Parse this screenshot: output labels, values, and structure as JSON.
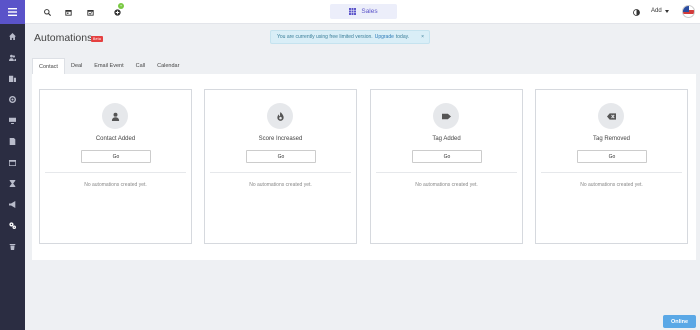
{
  "topbar": {
    "icons": [
      "search-icon",
      "calendar-icon",
      "calendar-check-icon",
      "add-circle-icon"
    ],
    "notification_count": "+",
    "workspace_label": "Sales",
    "add_label": "Add"
  },
  "sidebar": {
    "items": [
      "home-icon",
      "users-icon",
      "building-icon",
      "target-icon",
      "monitor-icon",
      "document-icon",
      "calendar-icon",
      "hourglass-icon",
      "megaphone-icon",
      "automation-icon",
      "trash-icon"
    ],
    "active": "automation-icon"
  },
  "page": {
    "title": "Automations",
    "beta_badge": "Beta"
  },
  "notice": {
    "text": "You are currently using free limited version.",
    "link": "Upgrade",
    "suffix": "today.",
    "close": "×"
  },
  "tabs": [
    {
      "label": "Contact",
      "active": true
    },
    {
      "label": "Deal",
      "active": false
    },
    {
      "label": "Email Event",
      "active": false
    },
    {
      "label": "Call",
      "active": false
    },
    {
      "label": "Calendar",
      "active": false
    }
  ],
  "cards": [
    {
      "title": "Contact Added",
      "icon": "person-icon",
      "button": "Go",
      "empty": "No automations created yet."
    },
    {
      "title": "Score Increased",
      "icon": "flame-icon",
      "button": "Go",
      "empty": "No automations created yet."
    },
    {
      "title": "Tag Added",
      "icon": "tag-icon",
      "button": "Go",
      "empty": "No automations created yet."
    },
    {
      "title": "Tag Removed",
      "icon": "tag-remove-icon",
      "button": "Go",
      "empty": "No automations created yet."
    }
  ],
  "online_button": "Online",
  "colors": {
    "sidebar": "#2b2d42",
    "accent": "#5a53c9",
    "online": "#5aa8e6",
    "notice_bg": "#d9eef7"
  }
}
